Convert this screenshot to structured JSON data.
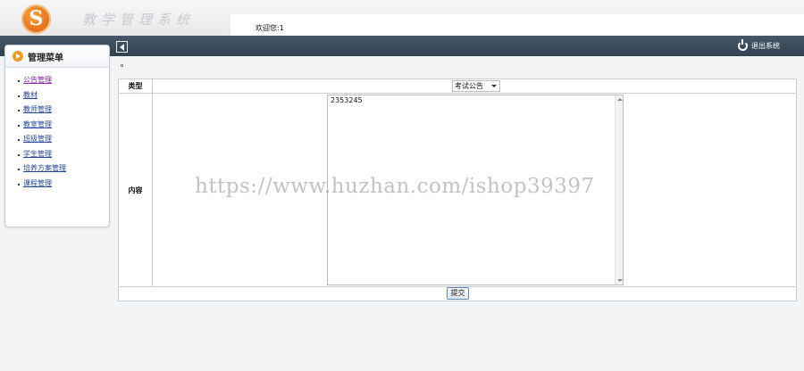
{
  "header": {
    "logo_letter": "S",
    "brand_title": "教学管理系统",
    "welcome_label": "欢迎您:",
    "welcome_user": "1",
    "logout_label": "退出系统"
  },
  "sidebar": {
    "title": "管理菜单",
    "items": [
      {
        "label": "公告管理"
      },
      {
        "label": "教材"
      },
      {
        "label": "教师管理"
      },
      {
        "label": "教室管理"
      },
      {
        "label": "班级管理"
      },
      {
        "label": "学生管理"
      },
      {
        "label": "培养方案管理"
      },
      {
        "label": "课程管理"
      }
    ]
  },
  "form": {
    "type_label": "类型",
    "type_value": "考试公告",
    "content_label": "内容",
    "content_value": "2353245",
    "submit_label": "提交"
  },
  "watermark": "https://www.huzhan.com/ishop39397",
  "colors": {
    "top_bar": "#384b5b",
    "accent_orange": "#f39a1e",
    "link_blue": "#2547a0",
    "link_visited": "#8b23a1"
  }
}
